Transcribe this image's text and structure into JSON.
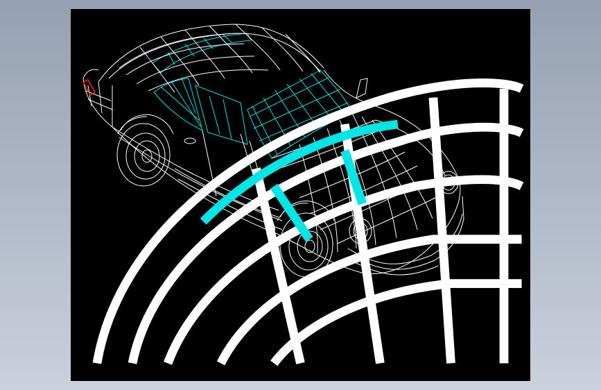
{
  "app": {
    "background_top": "#95a0b2",
    "background_bottom": "#c9d1dc"
  },
  "viewport": {
    "background": "#000000",
    "wire_color": "#ffffff",
    "glass_color": "#00e5e5",
    "tail_light_color": "#ff2020",
    "model": "car-wireframe"
  },
  "corner_preview": {
    "icon": "car-nose-preview-icon"
  }
}
